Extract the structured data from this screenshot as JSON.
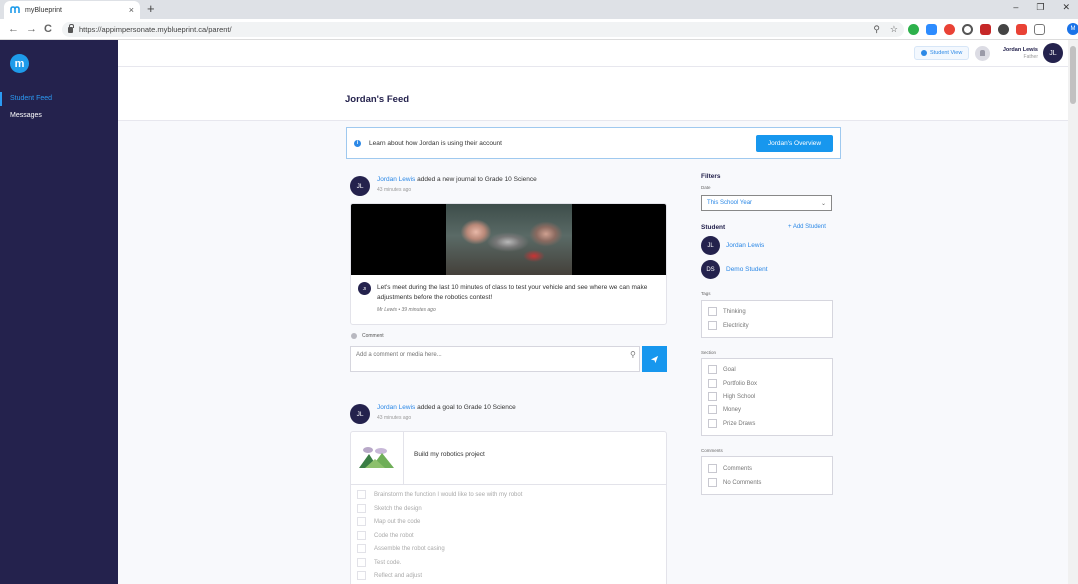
{
  "browser": {
    "tab_title": "myBlueprint",
    "url": "https://appimpersonate.myblueprint.ca/parent/",
    "new_tab": "+",
    "tab_close": "×",
    "win_min": "–",
    "win_restore": "❐",
    "win_close": "✕",
    "back": "←",
    "forward": "→",
    "reload": "C",
    "profile_initial": "M"
  },
  "colors": {
    "sidebar_bg": "#24224d",
    "accent": "#1797ee",
    "link": "#2b88e6"
  },
  "sidebar": {
    "logo": "m",
    "items": [
      {
        "label": "Student Feed",
        "active": true
      },
      {
        "label": "Messages",
        "active": false
      }
    ]
  },
  "header": {
    "student_view": "Student View",
    "user_name": "Jordan Lewis",
    "user_role": "Father",
    "avatar_initials": "JL"
  },
  "page": {
    "title": "Jordan's Feed"
  },
  "banner": {
    "text": "Learn about how Jordan is using their account",
    "button": "Jordan's Overview",
    "icon": "i"
  },
  "feed": [
    {
      "avatar": "JL",
      "author": "Jordan Lewis",
      "action": " added a new journal to Grade 10 Science",
      "time": "43 minutes ago",
      "comment": {
        "avatar": "JI",
        "text": "Let's meet during the last 10 minutes of class to test your vehicle and see where we can make adjustments before the robotics contest!",
        "author": "Mr Lewis • 39 minutes ago"
      },
      "comment_label": "Comment",
      "comment_placeholder": "Add a comment or media here..."
    },
    {
      "avatar": "JL",
      "author": "Jordan Lewis",
      "action": " added a goal to Grade 10 Science",
      "time": "43 minutes ago",
      "goal_title": "Build my robotics project",
      "tasks": [
        "Brainstorm the function I would like to see with my robot",
        "Sketch the design",
        "Map out the code",
        "Code the robot",
        "Assemble the robot casing",
        "Test code.",
        "Reflect and adjust"
      ]
    }
  ],
  "filters": {
    "heading": "Filters",
    "date_label": "Date",
    "date_value": "This School Year",
    "student_heading": "Student",
    "add_student": "+ Add Student",
    "students": [
      {
        "initials": "JL",
        "name": "Jordan Lewis"
      },
      {
        "initials": "DS",
        "name": "Demo Student"
      }
    ],
    "tags_label": "Tags",
    "tags": [
      "Thinking",
      "Electricity"
    ],
    "section_label": "Section",
    "sections": [
      "Goal",
      "Portfolio Box",
      "High School",
      "Money",
      "Prize Draws"
    ],
    "comments_label": "Comments",
    "comments": [
      "Comments",
      "No Comments"
    ]
  }
}
